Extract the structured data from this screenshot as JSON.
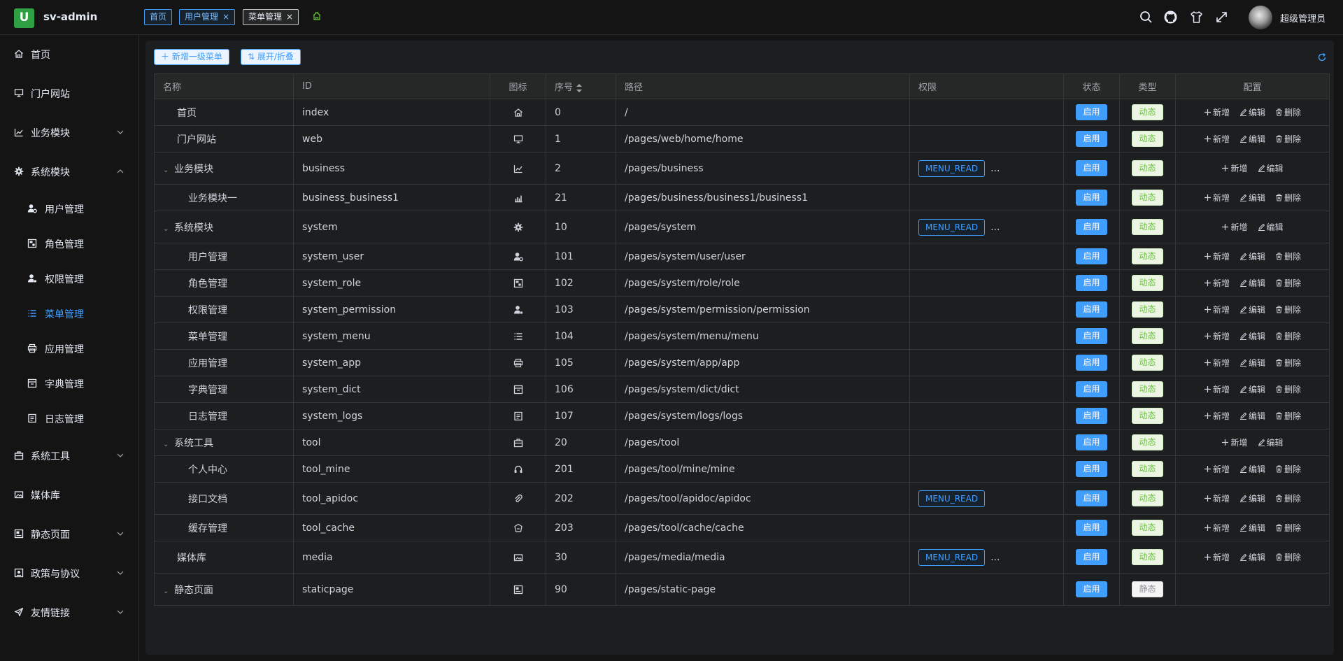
{
  "header": {
    "logo_char": "U",
    "app_name": "sv-admin",
    "tabs": [
      {
        "label": "首页",
        "closable": false
      },
      {
        "label": "用户管理",
        "closable": true
      },
      {
        "label": "菜单管理",
        "closable": true,
        "active": true
      }
    ],
    "close_glyph": "×",
    "user_name": "超级管理员"
  },
  "sidebar": {
    "items": [
      {
        "label": "首页",
        "icon": "home-icon",
        "expandable": false
      },
      {
        "label": "门户网站",
        "icon": "monitor-icon",
        "expandable": false
      },
      {
        "label": "业务模块",
        "icon": "chart-line-icon",
        "expandable": true,
        "expanded": false
      },
      {
        "label": "系统模块",
        "icon": "gear-icon",
        "expandable": true,
        "expanded": true
      },
      {
        "label": "用户管理",
        "icon": "user-gear-icon",
        "sub": true
      },
      {
        "label": "角色管理",
        "icon": "role-card-icon",
        "sub": true
      },
      {
        "label": "权限管理",
        "icon": "user-lock-icon",
        "sub": true
      },
      {
        "label": "菜单管理",
        "icon": "list-icon",
        "sub": true,
        "active": true
      },
      {
        "label": "应用管理",
        "icon": "printer-icon",
        "sub": true
      },
      {
        "label": "字典管理",
        "icon": "dict-box-icon",
        "sub": true
      },
      {
        "label": "日志管理",
        "icon": "log-doc-icon",
        "sub": true
      },
      {
        "label": "系统工具",
        "icon": "toolbox-icon",
        "expandable": true,
        "expanded": false
      },
      {
        "label": "媒体库",
        "icon": "media-icon",
        "expandable": false
      },
      {
        "label": "静态页面",
        "icon": "page-icon",
        "expandable": true,
        "expanded": false
      },
      {
        "label": "政策与协议",
        "icon": "policy-icon",
        "expandable": true,
        "expanded": false
      },
      {
        "label": "友情链接",
        "icon": "send-icon",
        "expandable": true,
        "expanded": false
      }
    ]
  },
  "toolbar": {
    "add_top_menu": "新增一级菜单",
    "expand_collapse": "展开/折叠"
  },
  "table": {
    "columns": [
      "名称",
      "ID",
      "图标",
      "序号",
      "路径",
      "权限",
      "状态",
      "类型",
      "配置"
    ],
    "actions": {
      "add": "新增",
      "edit": "编辑",
      "delete": "删除"
    },
    "more": "...",
    "rows": [
      {
        "name": "首页",
        "id": "index",
        "icon": "home-icon",
        "order": "0",
        "path": "/",
        "perm": "",
        "perm_more": false,
        "status": "启用",
        "type": "动态",
        "level": 0,
        "caret": false,
        "del": true
      },
      {
        "name": "门户网站",
        "id": "web",
        "icon": "monitor-icon",
        "order": "1",
        "path": "/pages/web/home/home",
        "perm": "",
        "perm_more": false,
        "status": "启用",
        "type": "动态",
        "level": 0,
        "caret": false,
        "del": true
      },
      {
        "name": "业务模块",
        "id": "business",
        "icon": "chart-line-icon",
        "order": "2",
        "path": "/pages/business",
        "perm": "MENU_READ",
        "perm_more": true,
        "status": "启用",
        "type": "动态",
        "level": 0,
        "caret": true,
        "del": false
      },
      {
        "name": "业务模块一",
        "id": "business_business1",
        "icon": "bar-chart-icon",
        "order": "21",
        "path": "/pages/business/business1/business1",
        "perm": "",
        "perm_more": false,
        "status": "启用",
        "type": "动态",
        "level": 1,
        "caret": false,
        "del": true
      },
      {
        "name": "系统模块",
        "id": "system",
        "icon": "gear-icon",
        "order": "10",
        "path": "/pages/system",
        "perm": "MENU_READ",
        "perm_more": true,
        "status": "启用",
        "type": "动态",
        "level": 0,
        "caret": true,
        "del": false
      },
      {
        "name": "用户管理",
        "id": "system_user",
        "icon": "user-gear-icon",
        "order": "101",
        "path": "/pages/system/user/user",
        "perm": "",
        "perm_more": false,
        "status": "启用",
        "type": "动态",
        "level": 1,
        "caret": false,
        "del": true
      },
      {
        "name": "角色管理",
        "id": "system_role",
        "icon": "role-card-icon",
        "order": "102",
        "path": "/pages/system/role/role",
        "perm": "",
        "perm_more": false,
        "status": "启用",
        "type": "动态",
        "level": 1,
        "caret": false,
        "del": true
      },
      {
        "name": "权限管理",
        "id": "system_permission",
        "icon": "user-lock-icon",
        "order": "103",
        "path": "/pages/system/permission/permission",
        "perm": "",
        "perm_more": false,
        "status": "启用",
        "type": "动态",
        "level": 1,
        "caret": false,
        "del": true
      },
      {
        "name": "菜单管理",
        "id": "system_menu",
        "icon": "list-icon",
        "order": "104",
        "path": "/pages/system/menu/menu",
        "perm": "",
        "perm_more": false,
        "status": "启用",
        "type": "动态",
        "level": 1,
        "caret": false,
        "del": true
      },
      {
        "name": "应用管理",
        "id": "system_app",
        "icon": "printer-icon",
        "order": "105",
        "path": "/pages/system/app/app",
        "perm": "",
        "perm_more": false,
        "status": "启用",
        "type": "动态",
        "level": 1,
        "caret": false,
        "del": true
      },
      {
        "name": "字典管理",
        "id": "system_dict",
        "icon": "dict-box-icon",
        "order": "106",
        "path": "/pages/system/dict/dict",
        "perm": "",
        "perm_more": false,
        "status": "启用",
        "type": "动态",
        "level": 1,
        "caret": false,
        "del": true
      },
      {
        "name": "日志管理",
        "id": "system_logs",
        "icon": "log-doc-icon",
        "order": "107",
        "path": "/pages/system/logs/logs",
        "perm": "",
        "perm_more": false,
        "status": "启用",
        "type": "动态",
        "level": 1,
        "caret": false,
        "del": true
      },
      {
        "name": "系统工具",
        "id": "tool",
        "icon": "toolbox-icon",
        "order": "20",
        "path": "/pages/tool",
        "perm": "",
        "perm_more": false,
        "status": "启用",
        "type": "动态",
        "level": 0,
        "caret": true,
        "del": false
      },
      {
        "name": "个人中心",
        "id": "tool_mine",
        "icon": "headset-icon",
        "order": "201",
        "path": "/pages/tool/mine/mine",
        "perm": "",
        "perm_more": false,
        "status": "启用",
        "type": "动态",
        "level": 1,
        "caret": false,
        "del": true
      },
      {
        "name": "接口文档",
        "id": "tool_apidoc",
        "icon": "paperclip-icon",
        "order": "202",
        "path": "/pages/tool/apidoc/apidoc",
        "perm": "MENU_READ",
        "perm_more": false,
        "status": "启用",
        "type": "动态",
        "level": 1,
        "caret": false,
        "del": true
      },
      {
        "name": "缓存管理",
        "id": "tool_cache",
        "icon": "cache-icon",
        "order": "203",
        "path": "/pages/tool/cache/cache",
        "perm": "",
        "perm_more": false,
        "status": "启用",
        "type": "动态",
        "level": 1,
        "caret": false,
        "del": true
      },
      {
        "name": "媒体库",
        "id": "media",
        "icon": "media-icon",
        "order": "30",
        "path": "/pages/media/media",
        "perm": "MENU_READ",
        "perm_more": true,
        "status": "启用",
        "type": "动态",
        "level": 0,
        "caret": false,
        "del": true
      },
      {
        "name": "静态页面",
        "id": "staticpage",
        "icon": "page-icon",
        "order": "90",
        "path": "/pages/static-page",
        "perm": "",
        "perm_more": false,
        "status": "启用",
        "type": "静态",
        "level": 0,
        "caret": true,
        "del": false,
        "no_actions": true
      }
    ]
  }
}
